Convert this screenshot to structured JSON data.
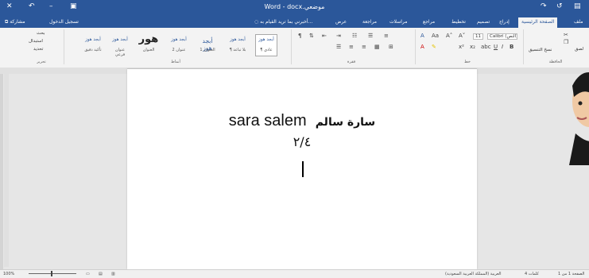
{
  "window": {
    "title": "Word - docx.موضعي",
    "close": "✕",
    "undo": "↶",
    "minimize": "–",
    "save": "▣"
  },
  "menu": {
    "share": "مشاركة",
    "signin": "تسجيل الدخول",
    "tellme": "أخبرني بما تريد القيام به...",
    "tabs": [
      "ملف",
      "الصفحة الرئيسية",
      "إدراج",
      "تصميم",
      "تخطيط",
      "مراجع",
      "مراسلات",
      "مراجعة",
      "عرض"
    ]
  },
  "ribbon": {
    "editing": {
      "find": "بحث",
      "replace": "استبدال",
      "select": "تحديد",
      "label": "تحرير"
    },
    "styles": {
      "items": [
        {
          "top": "أبجد هوز",
          "bottom": "¶ عادي"
        },
        {
          "top": "أبجد هوز",
          "bottom": "¶ بلا تباعد"
        },
        {
          "top": "أبجد هوز",
          "bottom": "العنوان 1"
        },
        {
          "top": "أبجد هوز",
          "bottom": "عنوان 2"
        },
        {
          "top": "هور",
          "bottom": "العنوان"
        },
        {
          "top": "أبجد هوز",
          "bottom": "عنوان فرعي"
        },
        {
          "top": "أبجد هوز",
          "bottom": "تأكيد دقيق"
        }
      ],
      "label": "أنماط"
    },
    "paragraph_label": "فقرة",
    "font": {
      "name": "Calibri (النص)",
      "size": "11",
      "label": "خط"
    },
    "clipboard": {
      "paste": "لصق",
      "format_painter": "نسخ التنسيق",
      "label": "الحافظة"
    }
  },
  "document": {
    "line1_latin": "sara salem",
    "line1_arabic": "سارة سالم",
    "line2": "٢/٤"
  },
  "status": {
    "zoom": "100%",
    "page": "الصفحة 1 من 1",
    "words": "4 كلمات",
    "language": "العربية (المملكة العربية السعودية)"
  }
}
